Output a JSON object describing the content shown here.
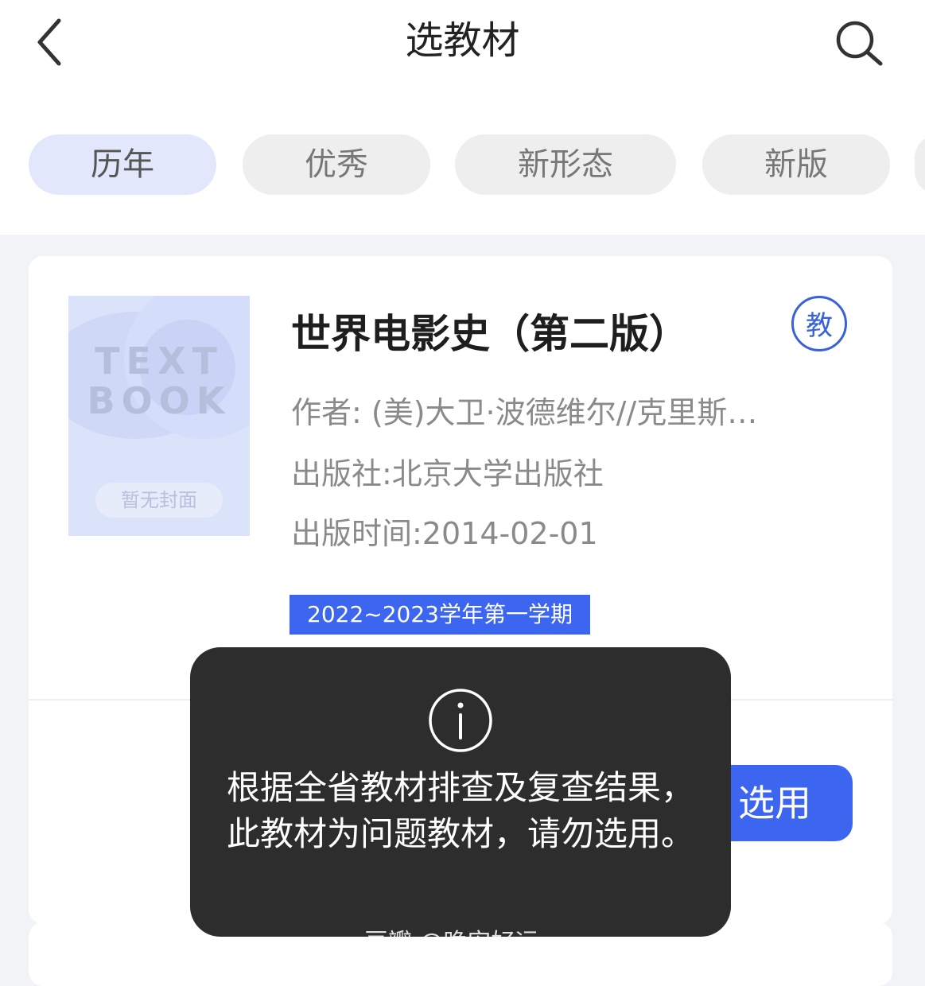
{
  "header": {
    "title": "选教材",
    "back_icon": "chevron-left-icon",
    "search_icon": "search-icon"
  },
  "tabs": [
    {
      "label": "历年",
      "active": true
    },
    {
      "label": "优秀",
      "active": false
    },
    {
      "label": "新形态",
      "active": false
    },
    {
      "label": "新版",
      "active": false
    }
  ],
  "book": {
    "cover_line1": "TEXT",
    "cover_line2": "BOOK",
    "cover_badge": "暂无封面",
    "title": "世界电影史（第二版）",
    "badge": "教",
    "author": "作者: (美)大卫·波德维尔//克里斯…",
    "publisher": "出版社:北京大学出版社",
    "publish_date": "出版时间:2014-02-01",
    "term": "2022~2023学年第一学期",
    "select_label": "选用"
  },
  "toast": {
    "icon": "info-icon",
    "message": "根据全省教材排查及复查结果，此教材为问题教材，请勿选用。"
  },
  "watermark": "豆瓣 @晚安好运",
  "colors": {
    "accent": "#3d66f0",
    "badge_border": "#3a62d8",
    "toast_bg": "#2d2d2d",
    "tab_active_bg": "#e2e7fb"
  }
}
